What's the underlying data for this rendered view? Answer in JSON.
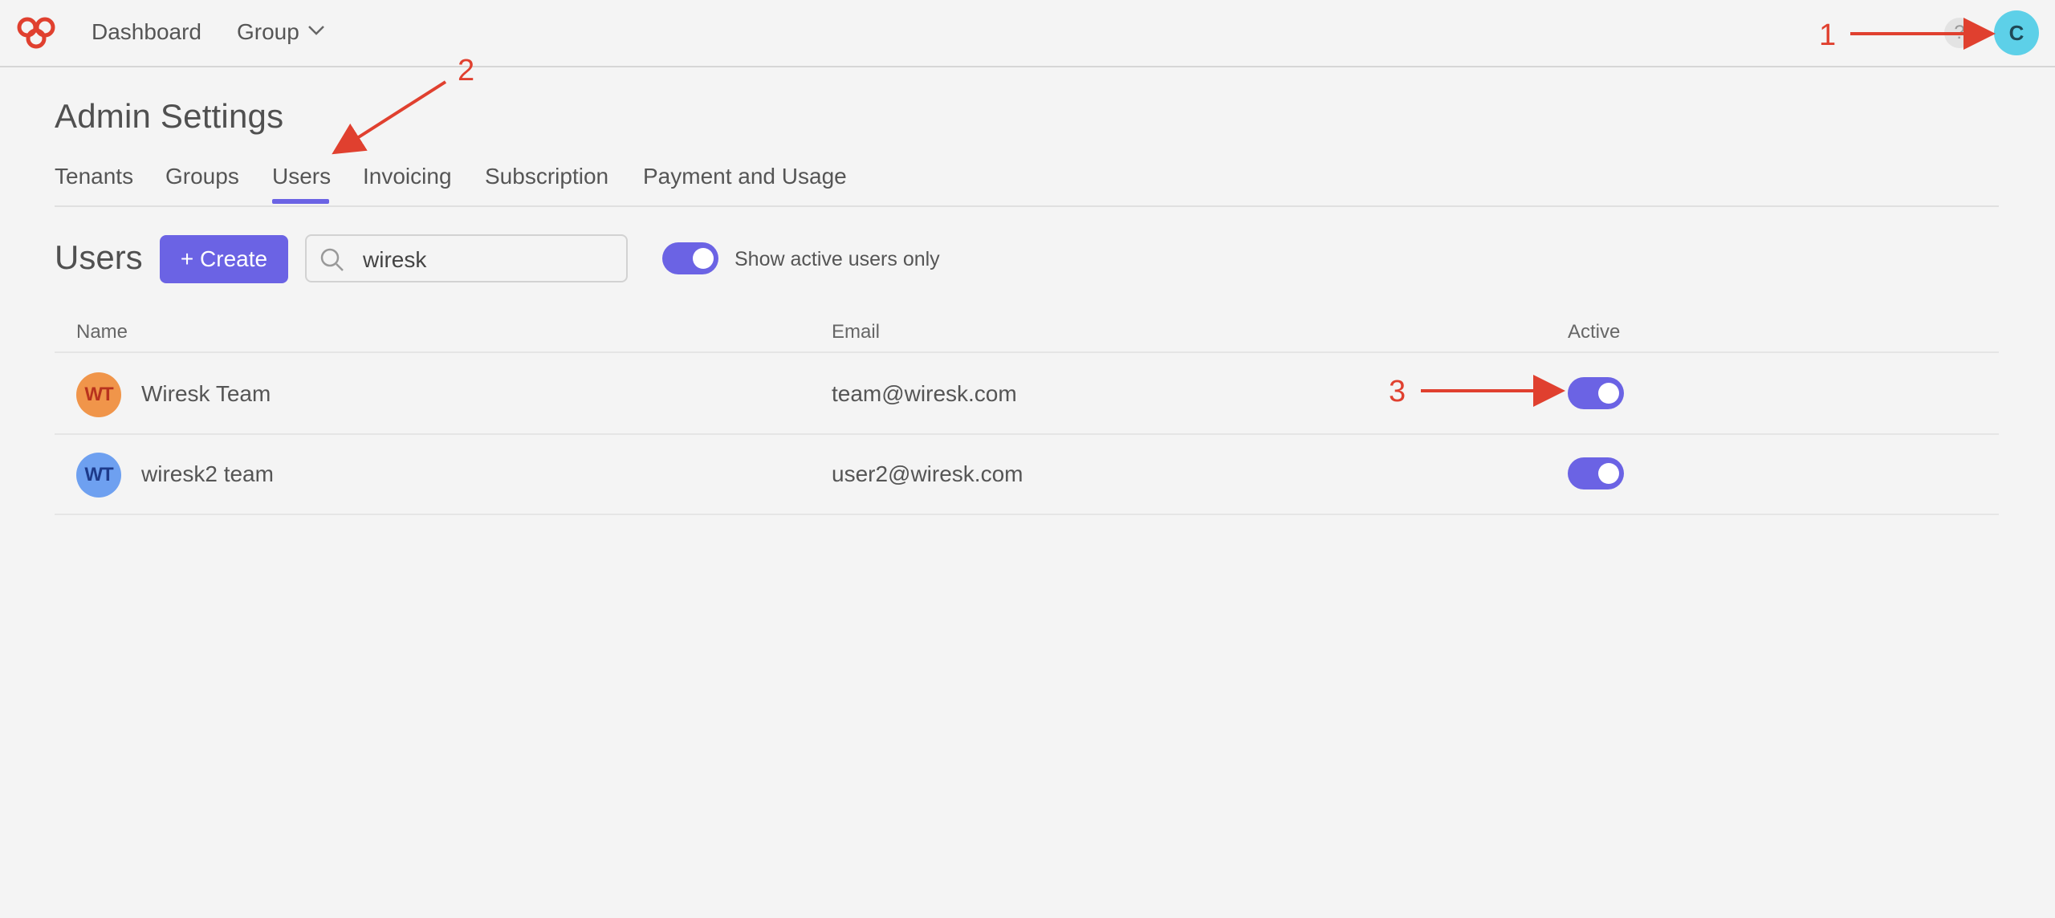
{
  "topbar": {
    "nav": [
      {
        "label": "Dashboard"
      },
      {
        "label": "Group"
      }
    ],
    "help_label": "?",
    "user_initial": "C",
    "colors": {
      "avatar_bg": "#5dd0e8",
      "logo": "#e0402f"
    }
  },
  "page": {
    "title": "Admin Settings",
    "tabs": [
      {
        "label": "Tenants"
      },
      {
        "label": "Groups"
      },
      {
        "label": "Users",
        "active": true
      },
      {
        "label": "Invoicing"
      },
      {
        "label": "Subscription"
      },
      {
        "label": "Payment and Usage"
      }
    ]
  },
  "users_section": {
    "title": "Users",
    "create_label": "+ Create",
    "search_value": "wiresk",
    "filter_label": "Show active users only",
    "filter_on": true
  },
  "table": {
    "columns": [
      "Name",
      "Email",
      "Active"
    ],
    "rows": [
      {
        "initials": "WT",
        "name": "Wiresk Team",
        "email": "team@wiresk.com",
        "active": true,
        "avatar_bg": "#f0954a",
        "avatar_fg": "#b8321e"
      },
      {
        "initials": "WT",
        "name": "wiresk2 team",
        "email": "user2@wiresk.com",
        "active": true,
        "avatar_bg": "#6ea0f0",
        "avatar_fg": "#1e3a8a"
      }
    ]
  },
  "annotations": [
    {
      "label": "1"
    },
    {
      "label": "2"
    },
    {
      "label": "3"
    }
  ],
  "colors": {
    "accent": "#6b63e4",
    "annotation": "#e0402f"
  }
}
